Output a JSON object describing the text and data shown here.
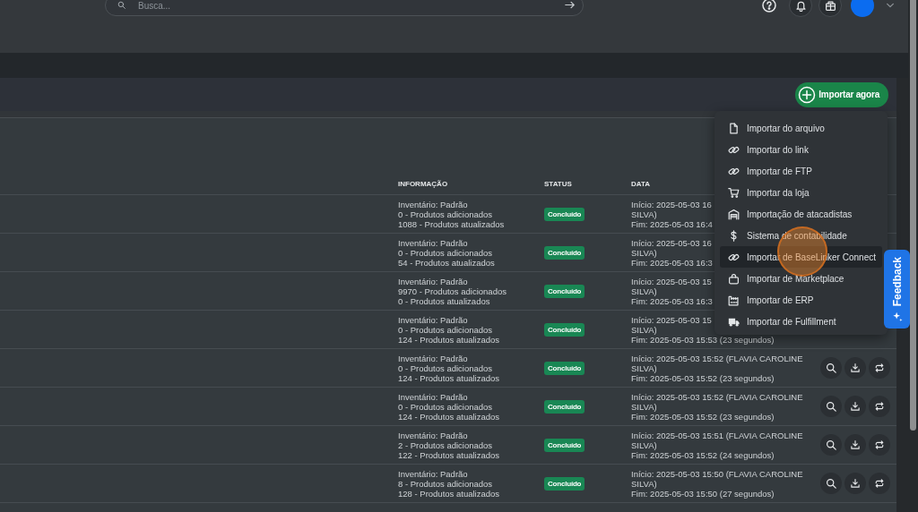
{
  "top_bar": {
    "search": {
      "placeholder": "Busca..."
    }
  },
  "panel": {
    "import_button": {
      "label": "Importar agora",
      "expanded": true
    },
    "import_menu": [
      {
        "label": "Importar do arquivo",
        "hovered": false
      },
      {
        "label": "Importar do link",
        "hovered": false
      },
      {
        "label": "Importar de FTP",
        "hovered": false
      },
      {
        "label": "Importar da loja",
        "hovered": false
      },
      {
        "label": "Importação de atacadistas",
        "hovered": false
      },
      {
        "label": "Sistema de contabilidade",
        "hovered": false
      },
      {
        "label": "Importar de BaseLinker Connect",
        "hovered": true
      },
      {
        "label": "Importar de Marketplace",
        "hovered": false
      },
      {
        "label": "Importar de ERP",
        "hovered": false
      },
      {
        "label": "Importar de Fulfillment",
        "hovered": false
      }
    ],
    "table": {
      "columns": [
        "INFORMAÇÃO",
        "STATUS",
        "DATA"
      ],
      "rows": [
        {
          "info": [
            "Inventário: Padrão",
            "0 - Produtos adicionados",
            "1088 - Produtos atualizados"
          ],
          "status": "Concluído",
          "date": [
            "Início: 2025-05-03 16",
            "SILVA)",
            "Fim: 2025-05-03 16:4"
          ],
          "actions_shown": false
        },
        {
          "info": [
            "Inventário: Padrão",
            "0 - Produtos adicionados",
            "54 - Produtos atualizados"
          ],
          "status": "Concluído",
          "date": [
            "Início: 2025-05-03 16",
            "SILVA)",
            "Fim: 2025-05-03 16:3"
          ],
          "actions_shown": false
        },
        {
          "info": [
            "Inventário: Padrão",
            "9970 - Produtos adicionados",
            "0 - Produtos atualizados"
          ],
          "status": "Concluído",
          "date": [
            "Início: 2025-05-03 15",
            "SILVA)",
            "Fim: 2025-05-03 16:3"
          ],
          "actions_shown": false
        },
        {
          "info": [
            "Inventário: Padrão",
            "0 - Produtos adicionados",
            "124 - Produtos atualizados"
          ],
          "status": "Concluído",
          "date": [
            "Início: 2025-05-03 15",
            "SILVA)",
            "Fim: 2025-05-03 15:53 (23 segundos)"
          ],
          "actions_shown": false
        },
        {
          "info": [
            "Inventário: Padrão",
            "0 - Produtos adicionados",
            "124 - Produtos atualizados"
          ],
          "status": "Concluído",
          "date": [
            "Início: 2025-05-03 15:52 (FLAVIA CAROLINE",
            "SILVA)",
            "Fim: 2025-05-03 15:52 (23 segundos)"
          ],
          "actions_shown": true
        },
        {
          "info": [
            "Inventário: Padrão",
            "0 - Produtos adicionados",
            "124 - Produtos atualizados"
          ],
          "status": "Concluído",
          "date": [
            "Início: 2025-05-03 15:52 (FLAVIA CAROLINE",
            "SILVA)",
            "Fim: 2025-05-03 15:52 (23 segundos)"
          ],
          "actions_shown": true
        },
        {
          "info": [
            "Inventário: Padrão",
            "2 - Produtos adicionados",
            "122 - Produtos atualizados"
          ],
          "status": "Concluído",
          "date": [
            "Início: 2025-05-03 15:51 (FLAVIA CAROLINE",
            "SILVA)",
            "Fim: 2025-05-03 15:52 (24 segundos)"
          ],
          "actions_shown": true
        },
        {
          "info": [
            "Inventário: Padrão",
            "8 - Produtos adicionados",
            "128 - Produtos atualizados"
          ],
          "status": "Concluído",
          "date": [
            "Início: 2025-05-03 15:50 (FLAVIA CAROLINE",
            "SILVA)",
            "Fim: 2025-05-03 15:50 (27 segundos)"
          ],
          "actions_shown": true
        }
      ]
    }
  },
  "feedback_tab": {
    "label": "Feedback"
  }
}
